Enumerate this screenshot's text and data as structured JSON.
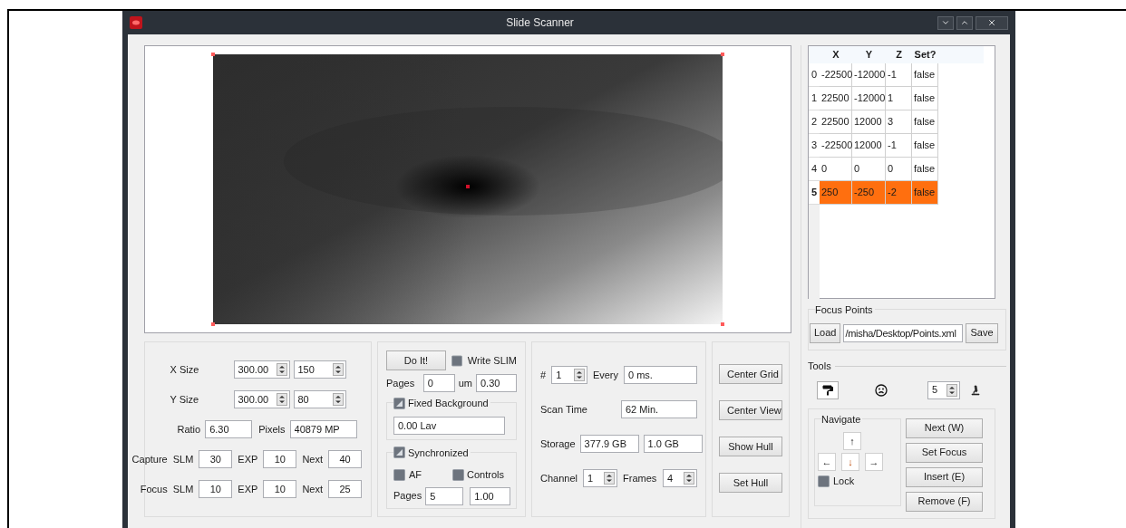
{
  "window": {
    "title": "Slide Scanner"
  },
  "scan_setup": {
    "x_size": {
      "label": "X Size",
      "value": "300.00",
      "count": "150"
    },
    "y_size": {
      "label": "Y Size",
      "value": "300.00",
      "count": "80"
    },
    "ratio": {
      "label": "Ratio",
      "value": "6.30"
    },
    "pixels": {
      "label": "Pixels",
      "value": "40879 MP"
    },
    "rows": [
      {
        "label": "Capture",
        "fields": [
          {
            "label": "SLM",
            "value": "30"
          },
          {
            "label": "EXP",
            "value": "10"
          },
          {
            "label": "Next",
            "value": "40"
          }
        ]
      },
      {
        "label": "Focus",
        "fields": [
          {
            "label": "SLM",
            "value": "10"
          },
          {
            "label": "EXP",
            "value": "10"
          },
          {
            "label": "Next",
            "value": "25"
          }
        ]
      }
    ]
  },
  "acquisition": {
    "do_it": "Do It!",
    "write_slim": {
      "label": "Write SLIM",
      "checked": false
    },
    "pages": {
      "label": "Pages",
      "value": "0"
    },
    "um": {
      "label": "um",
      "value": "0.30"
    },
    "fixed_background": {
      "label": "Fixed Background",
      "checked": true,
      "value": "0.00 Lav"
    },
    "synchronized": {
      "label": "Synchronized",
      "checked": true,
      "af": {
        "label": "AF",
        "checked": false
      },
      "controls": {
        "label": "Controls",
        "checked": false
      },
      "pages": {
        "label": "Pages",
        "value": "5"
      },
      "factor": "1.00"
    }
  },
  "timing": {
    "count": {
      "label": "#",
      "value": "1"
    },
    "every": {
      "label": "Every",
      "value": "0 ms."
    },
    "scan_time": {
      "label": "Scan Time",
      "value": "62 Min."
    },
    "storage": {
      "label": "Storage",
      "values": [
        "377.9 GB",
        "1.0 GB"
      ]
    },
    "channel": {
      "label": "Channel",
      "value": "1"
    },
    "frames": {
      "label": "Frames",
      "value": "4"
    }
  },
  "view_buttons": [
    "Center Grid",
    "Center View",
    "Show Hull",
    "Set Hull"
  ],
  "focus_table": {
    "columns": [
      "X",
      "Y",
      "Z",
      "Set?"
    ],
    "rows": [
      {
        "index": "0",
        "cells": [
          "-22500",
          "-12000",
          "-1",
          "false"
        ],
        "selected": false
      },
      {
        "index": "1",
        "cells": [
          "22500",
          "-12000",
          "1",
          "false"
        ],
        "selected": false
      },
      {
        "index": "2",
        "cells": [
          "22500",
          "12000",
          "3",
          "false"
        ],
        "selected": false
      },
      {
        "index": "3",
        "cells": [
          "-22500",
          "12000",
          "-1",
          "false"
        ],
        "selected": false
      },
      {
        "index": "4",
        "cells": [
          "0",
          "0",
          "0",
          "false"
        ],
        "selected": false
      },
      {
        "index": "5",
        "cells": [
          "250",
          "-250",
          "-2",
          "false"
        ],
        "selected": true
      }
    ]
  },
  "focus_points": {
    "title": "Focus Points",
    "load": "Load",
    "path": "/misha/Desktop/Points.xml",
    "save": "Save"
  },
  "tools": {
    "title": "Tools",
    "size": "5"
  },
  "navigate": {
    "title": "Navigate",
    "up": "↑",
    "left": "←",
    "down": "↓",
    "right": "→",
    "lock": {
      "label": "Lock",
      "checked": false
    },
    "buttons": [
      "Next (W)",
      "Set Focus",
      "Insert (E)",
      "Remove (F)"
    ]
  }
}
